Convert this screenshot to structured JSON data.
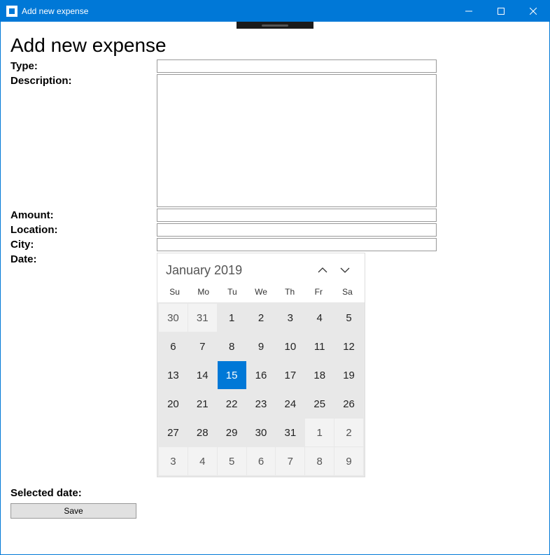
{
  "window": {
    "title": "Add new expense"
  },
  "page": {
    "heading": "Add new expense"
  },
  "form": {
    "type": {
      "label": "Type:",
      "value": ""
    },
    "description": {
      "label": "Description:",
      "value": ""
    },
    "amount": {
      "label": "Amount:",
      "value": ""
    },
    "location": {
      "label": "Location:",
      "value": ""
    },
    "city": {
      "label": "City:",
      "value": ""
    },
    "date": {
      "label": "Date:"
    }
  },
  "calendar": {
    "header": "January 2019",
    "dow": [
      "Su",
      "Mo",
      "Tu",
      "We",
      "Th",
      "Fr",
      "Sa"
    ],
    "selected_day": 15,
    "weeks": [
      [
        {
          "n": 30,
          "o": true
        },
        {
          "n": 31,
          "o": true
        },
        {
          "n": 1
        },
        {
          "n": 2
        },
        {
          "n": 3
        },
        {
          "n": 4
        },
        {
          "n": 5
        }
      ],
      [
        {
          "n": 6
        },
        {
          "n": 7
        },
        {
          "n": 8
        },
        {
          "n": 9
        },
        {
          "n": 10
        },
        {
          "n": 11
        },
        {
          "n": 12
        }
      ],
      [
        {
          "n": 13
        },
        {
          "n": 14
        },
        {
          "n": 15,
          "sel": true
        },
        {
          "n": 16
        },
        {
          "n": 17
        },
        {
          "n": 18
        },
        {
          "n": 19
        }
      ],
      [
        {
          "n": 20
        },
        {
          "n": 21
        },
        {
          "n": 22
        },
        {
          "n": 23
        },
        {
          "n": 24
        },
        {
          "n": 25
        },
        {
          "n": 26
        }
      ],
      [
        {
          "n": 27
        },
        {
          "n": 28
        },
        {
          "n": 29
        },
        {
          "n": 30
        },
        {
          "n": 31
        },
        {
          "n": 1,
          "o": true
        },
        {
          "n": 2,
          "o": true
        }
      ],
      [
        {
          "n": 3,
          "o": true
        },
        {
          "n": 4,
          "o": true
        },
        {
          "n": 5,
          "o": true
        },
        {
          "n": 6,
          "o": true
        },
        {
          "n": 7,
          "o": true
        },
        {
          "n": 8,
          "o": true
        },
        {
          "n": 9,
          "o": true
        }
      ]
    ]
  },
  "selected_date": {
    "label": "Selected date:",
    "value": ""
  },
  "buttons": {
    "save": "Save"
  }
}
